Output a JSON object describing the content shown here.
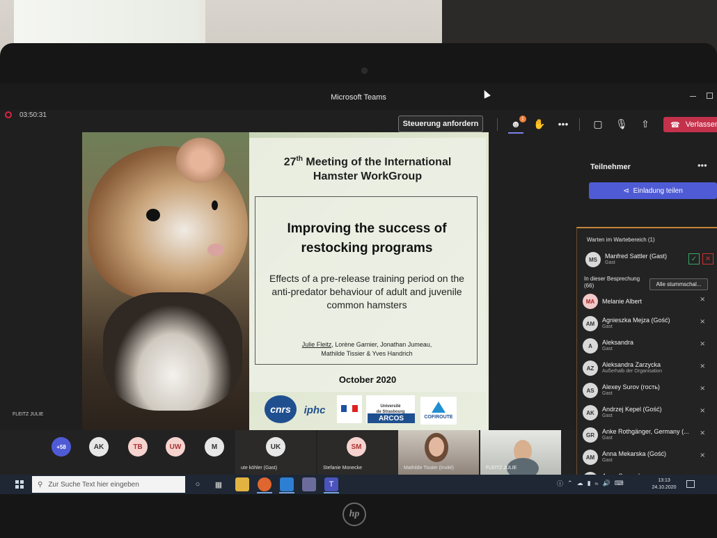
{
  "window": {
    "title": "Microsoft Teams"
  },
  "toolbar": {
    "timer": "03:50:31",
    "request_control_label": "Steuerung anfordern",
    "participants_badge": "1",
    "more_label": "•••",
    "leave_label": "Verlassen"
  },
  "slide": {
    "heading_ordinal": "27",
    "heading_suffix": "th",
    "heading_line1_rest": " Meeting of the International",
    "heading_line2": "Hamster WorkGroup",
    "main_title_line1": "Improving the success of",
    "main_title_line2": "restocking programs",
    "subtitle": "Effects of a pre-release training period on the anti-predator behaviour of adult and juvenile common hamsters",
    "authors_line1_first": "Julie Fleitz",
    "authors_line1_rest": ", Lorène Garnier, Jonathan Jumeau,",
    "authors_line2": "Mathilde Tissier & Yves Handrich",
    "date": "October 2020",
    "logos": {
      "cnrs": "cnrs",
      "iphc": "iphc",
      "university_line1": "Université",
      "university_line2": "de Strasbourg",
      "arcos": "ARCOS",
      "cofiroute": "COFIROUTE"
    }
  },
  "presenter_label": "FLEITZ JULIE",
  "participants_panel": {
    "title": "Teilnehmer",
    "more": "•••",
    "invite_label": "Einladung teilen",
    "waiting_section": "Warten im Wartebereich (1)",
    "waiting": [
      {
        "initials": "MS",
        "name": "Manfred Sattler (Gast)",
        "sub": "Gast"
      }
    ],
    "meeting_section_line1": "In dieser Besprechung",
    "meeting_section_line2": "(66)",
    "mute_all_label": "Alle stummschal...",
    "people": [
      {
        "initials": "MA",
        "name": "Melanie Albert",
        "sub": ""
      },
      {
        "initials": "AM",
        "name": "Agnieszka Mejza (Gość)",
        "sub": "Gast"
      },
      {
        "initials": "A",
        "name": "Aleksandra",
        "sub": "Gast"
      },
      {
        "initials": "AZ",
        "name": "Aleksandra Zarzycka",
        "sub": "Außerhalb der Organisation"
      },
      {
        "initials": "AS",
        "name": "Alexey Surov (гость)",
        "sub": "Gast"
      },
      {
        "initials": "AK",
        "name": "Andrzej Kepel (Gość)",
        "sub": "Gast"
      },
      {
        "initials": "GR",
        "name": "Anke Rothgänger, Germany (...",
        "sub": "Gast"
      },
      {
        "initials": "AM",
        "name": "Anna Mekarska (Gość)",
        "sub": "Gast"
      },
      {
        "initials": "",
        "name": "Anna Smugała",
        "sub": ""
      }
    ]
  },
  "gallery": {
    "overflow": "+58",
    "avatars": [
      "AK",
      "TB",
      "UW",
      "M"
    ],
    "tiles": [
      {
        "initials": "UK",
        "label": "ute köhler (Gast)"
      },
      {
        "initials": "SM",
        "label": "Stefanie Monecke"
      }
    ],
    "video_labels": [
      "Mathilde Tissier (Invité)",
      "FLEITZ JULIE"
    ]
  },
  "taskbar": {
    "search_placeholder": "Zur Suche Text hier eingeben",
    "time": "13:13",
    "date": "24.10.2020"
  },
  "hp_logo": "hp"
}
